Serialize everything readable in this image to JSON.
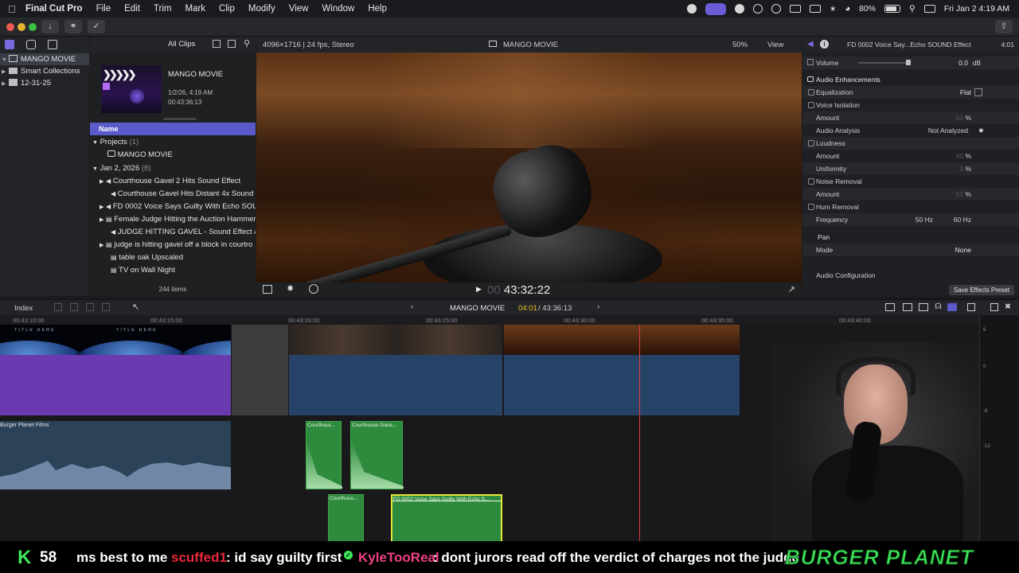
{
  "menubar": {
    "app_name": "Final Cut Pro",
    "items": [
      "File",
      "Edit",
      "Trim",
      "Mark",
      "Clip",
      "Modify",
      "View",
      "Window",
      "Help"
    ],
    "battery": "80%",
    "datetime": "Fri Jan 2  4:19 AM"
  },
  "browser": {
    "filter": "All Clips",
    "library_name": "MANGO MOVIE",
    "sidebar": [
      {
        "label": "MANGO MOVIE",
        "icon": "library-icon"
      },
      {
        "label": "Smart Collections",
        "icon": "folder-icon"
      },
      {
        "label": "12-31-25",
        "icon": "event-icon"
      }
    ],
    "project": {
      "title": "MANGO MOVIE",
      "date": "1/2/26, 4:19 AM",
      "duration": "00:43:36:13"
    },
    "column_header": "Name",
    "groups": [
      {
        "label": "Projects",
        "count": "(1)",
        "items": [
          "MANGO MOVIE"
        ]
      },
      {
        "label": "Jan 2, 2026",
        "count": "(8)",
        "items": [
          "Courthouse Gavel 2 Hits Sound Effect",
          "Courthouse Gavel Hits Distant 4x Sound Ef",
          "FD 0002  Voice Says Guilty With Echo SOU",
          "Female Judge Hitting the Auction Hammer",
          "JUDGE HITTING GAVEL - Sound Effect & V",
          "judge is hitting gavel off a block in courtro",
          "table oak Upscaled",
          "TV on Wall Night"
        ]
      }
    ],
    "item_count": "244 items"
  },
  "viewer": {
    "format": "4096×1716 | 24 fps, Stereo",
    "project": "MANGO MOVIE",
    "zoom": "50%",
    "view_label": "View",
    "timecode_dim": "00",
    "timecode": "43:32:22"
  },
  "inspector": {
    "clip_name": "FD 0002  Voice Say...Echo SOUND Effect",
    "clip_time": "4:01",
    "volume_label": "Volume",
    "volume_value": "0.0",
    "volume_unit": "dB",
    "section": "Audio Enhancements",
    "rows": {
      "equalization": {
        "label": "Equalization",
        "value": "Flat"
      },
      "voice_isolation": "Voice Isolation",
      "vi_amount": {
        "label": "Amount",
        "value": "50",
        "unit": "%"
      },
      "audio_analysis": {
        "label": "Audio Analysis",
        "value": "Not Analyzed"
      },
      "loudness": "Loudness",
      "loud_amount": {
        "label": "Amount",
        "value": "40",
        "unit": "%"
      },
      "uniformity": {
        "label": "Uniformity",
        "value": "3",
        "unit": "%"
      },
      "noise_removal": "Noise Removal",
      "nr_amount": {
        "label": "Amount",
        "value": "50",
        "unit": "%"
      },
      "hum_removal": "Hum Removal",
      "frequency": {
        "label": "Frequency",
        "opt1": "50 Hz",
        "opt2": "60 Hz"
      },
      "pan": "Pan",
      "mode": {
        "label": "Mode",
        "value": "None"
      },
      "audio_config": "Audio Configuration"
    },
    "save_button": "Save Effects Preset"
  },
  "timeline": {
    "index_label": "Index",
    "project": "MANGO MOVIE",
    "position": "04:01",
    "duration": "43:36:13",
    "ruler": [
      "00:43:10:00",
      "00:43:15:00",
      "00:43:20:00",
      "00:43:25:00",
      "00:43:30:00",
      "00:43:35:00",
      "00:43:40:00"
    ],
    "title_clip_text": "TITLE HERE",
    "audio_clips": [
      "Burger Planet Films",
      "Courthous...",
      "Courthouse Gave...",
      "Courthous...",
      "FD 0002  Voice Says Guilty With Echo S..."
    ],
    "meter_scale": [
      "6",
      "0",
      "-6",
      "-12"
    ]
  },
  "chat": {
    "k_letter": "K",
    "viewer_count": "58",
    "msg1": "ms best to me",
    "user2": "scuffed1",
    "msg2": ": id say guilty first",
    "user3": "KyleTooReal",
    "msg3": ": dont jurors read off the verdict of charges not the judge",
    "brand": "BURGER PLANET"
  },
  "colors": {
    "accent": "#5a5acb",
    "playhead": "#e04040",
    "audio_clip": "#2e8a3c",
    "selected_clip_border": "#e6e63a",
    "chat_green": "#3ee65a",
    "chat_red": "#e8293b",
    "chat_pink": "#f04088"
  }
}
